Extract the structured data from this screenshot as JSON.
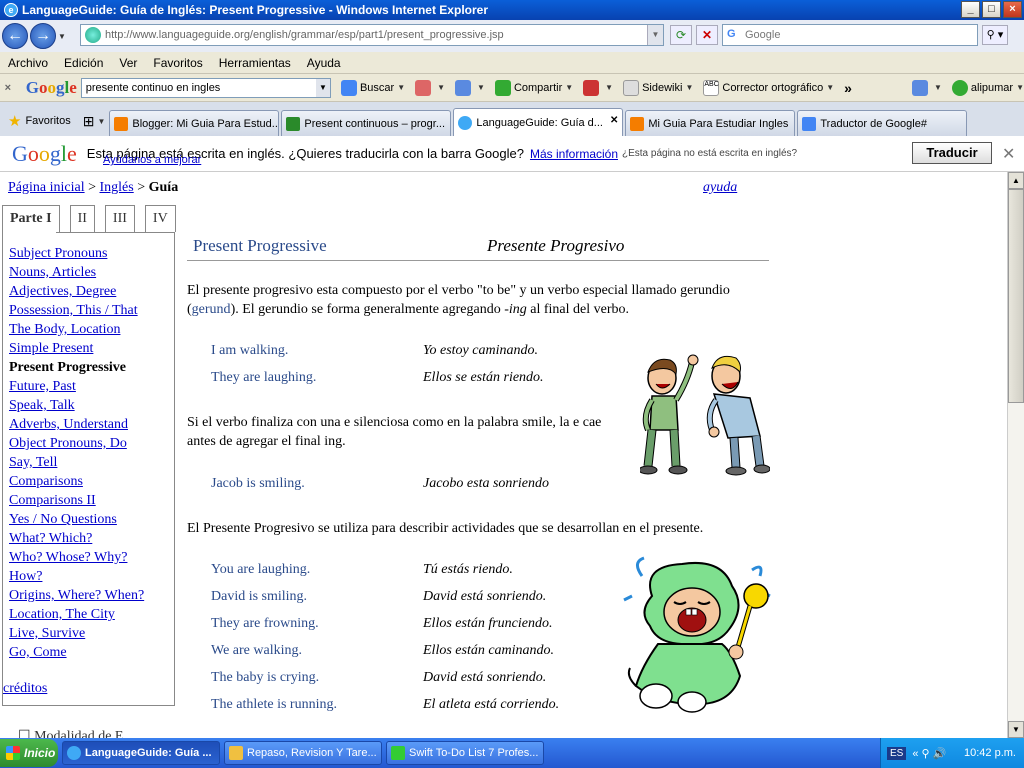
{
  "window": {
    "title": "LanguageGuide: Guía de Inglés: Present Progressive - Windows Internet Explorer",
    "minimize": "_",
    "maximize": "□",
    "close": "×"
  },
  "address": {
    "url": "http://www.languageguide.org/english/grammar/esp/part1/present_progressive.jsp",
    "search_placeholder": "Google"
  },
  "menu": [
    "Archivo",
    "Edición",
    "Ver",
    "Favoritos",
    "Herramientas",
    "Ayuda"
  ],
  "gtoolbar": {
    "search_value": "presente continuo en ingles",
    "buscar": "Buscar",
    "compartir": "Compartir",
    "sidewiki": "Sidewiki",
    "corrector": "Corrector ortográfico",
    "more": "»",
    "user": "alipumar"
  },
  "favorites_label": "Favoritos",
  "tabs": [
    {
      "label": "Blogger: Mi Guia Para Estud...",
      "color": "#f57d00",
      "active": false
    },
    {
      "label": "Present continuous – progr...",
      "color": "#2a8a2a",
      "active": false
    },
    {
      "label": "LanguageGuide: Guía d...",
      "color": "#3fa9f5",
      "active": true
    },
    {
      "label": "Mi Guia Para Estudiar Ingles",
      "color": "#f57d00",
      "active": false
    },
    {
      "label": "Traductor de Google#",
      "color": "#4285f4",
      "active": false
    }
  ],
  "translate": {
    "message": "Esta página está escrita en inglés. ¿Quieres traducirla con la barra Google?",
    "more_info": "Más información",
    "not_english": "¿Esta página no está escrita en inglés?",
    "help": "Ayúdanos a mejorar",
    "button": "Traducir"
  },
  "breadcrumb": {
    "home": "Página inicial",
    "sep1": " > ",
    "english": "Inglés",
    "sep2": " > ",
    "current": "Guía"
  },
  "help_link": "ayuda",
  "part_tabs": [
    "Parte I",
    "II",
    "III",
    "IV"
  ],
  "sidebar": [
    {
      "label": "Subject Pronouns",
      "current": false
    },
    {
      "label": "Nouns, Articles",
      "current": false
    },
    {
      "label": "Adjectives, Degree",
      "current": false
    },
    {
      "label": "Possession, This / That",
      "current": false
    },
    {
      "label": "The Body, Location",
      "current": false
    },
    {
      "label": "Simple Present",
      "current": false
    },
    {
      "label": "Present Progressive",
      "current": true
    },
    {
      "label": "Future, Past",
      "current": false
    },
    {
      "label": "Speak, Talk",
      "current": false
    },
    {
      "label": "Adverbs, Understand",
      "current": false
    },
    {
      "label": "Object Pronouns, Do",
      "current": false
    },
    {
      "label": "Say, Tell",
      "current": false
    },
    {
      "label": "Comparisons",
      "current": false
    },
    {
      "label": "Comparisons II",
      "current": false
    },
    {
      "label": "Yes / No Questions",
      "current": false
    },
    {
      "label": "What? Which?",
      "current": false
    },
    {
      "label": "Who? Whose? Why?",
      "current": false
    },
    {
      "label": "How?",
      "current": false
    },
    {
      "label": "Origins, Where? When?",
      "current": false
    },
    {
      "label": "Location, The City",
      "current": false
    },
    {
      "label": "Live, Survive",
      "current": false
    },
    {
      "label": "Go, Come",
      "current": false
    }
  ],
  "credits": "créditos",
  "cutoff_text": "Modalidad de E",
  "lesson": {
    "title_en": "Present Progressive",
    "title_es": "Presente Progresivo",
    "intro_a": "El presente progresivo esta compuesto por el verbo \"to be\" y un verbo especial llamado gerundio (",
    "intro_gerund": "gerund",
    "intro_b": "). El gerundio se forma generalmente agregando -",
    "intro_ing": "ing",
    "intro_c": " al final del verbo.",
    "examples1": [
      {
        "en": "I am walking.",
        "es": "Yo estoy caminando."
      },
      {
        "en": "They are laughing.",
        "es": "Ellos se están riendo."
      }
    ],
    "rule_e": "Si el verbo finaliza con una e silenciosa como en la palabra smile, la e cae antes de agregar el final ing.",
    "examples2": [
      {
        "en": "Jacob is smiling.",
        "es": "Jacobo esta sonriendo"
      }
    ],
    "usage": "El Presente Progresivo se utiliza para describir actividades que se desarrollan en el presente.",
    "examples3": [
      {
        "en": "You are laughing.",
        "es": "Tú estás riendo."
      },
      {
        "en": "David is smiling.",
        "es": "David está sonriendo."
      },
      {
        "en": "They are frowning.",
        "es": "Ellos están frunciendo."
      },
      {
        "en": "We are walking.",
        "es": "Ellos están caminando."
      },
      {
        "en": "The baby is crying.",
        "es": "David está sonriendo."
      },
      {
        "en": "The athlete is running.",
        "es": "El atleta está corriendo."
      }
    ]
  },
  "taskbar": {
    "start": "Inicio",
    "tasks": [
      {
        "label": "LanguageGuide: Guía ...",
        "color": "#3fa9f5",
        "active": true
      },
      {
        "label": "Repaso, Revision Y Tare...",
        "color": "#f0c040",
        "active": false
      },
      {
        "label": "Swift To-Do List 7 Profes...",
        "color": "#3c3",
        "active": false
      }
    ],
    "lang": "ES",
    "clock": "10:42 p.m."
  }
}
